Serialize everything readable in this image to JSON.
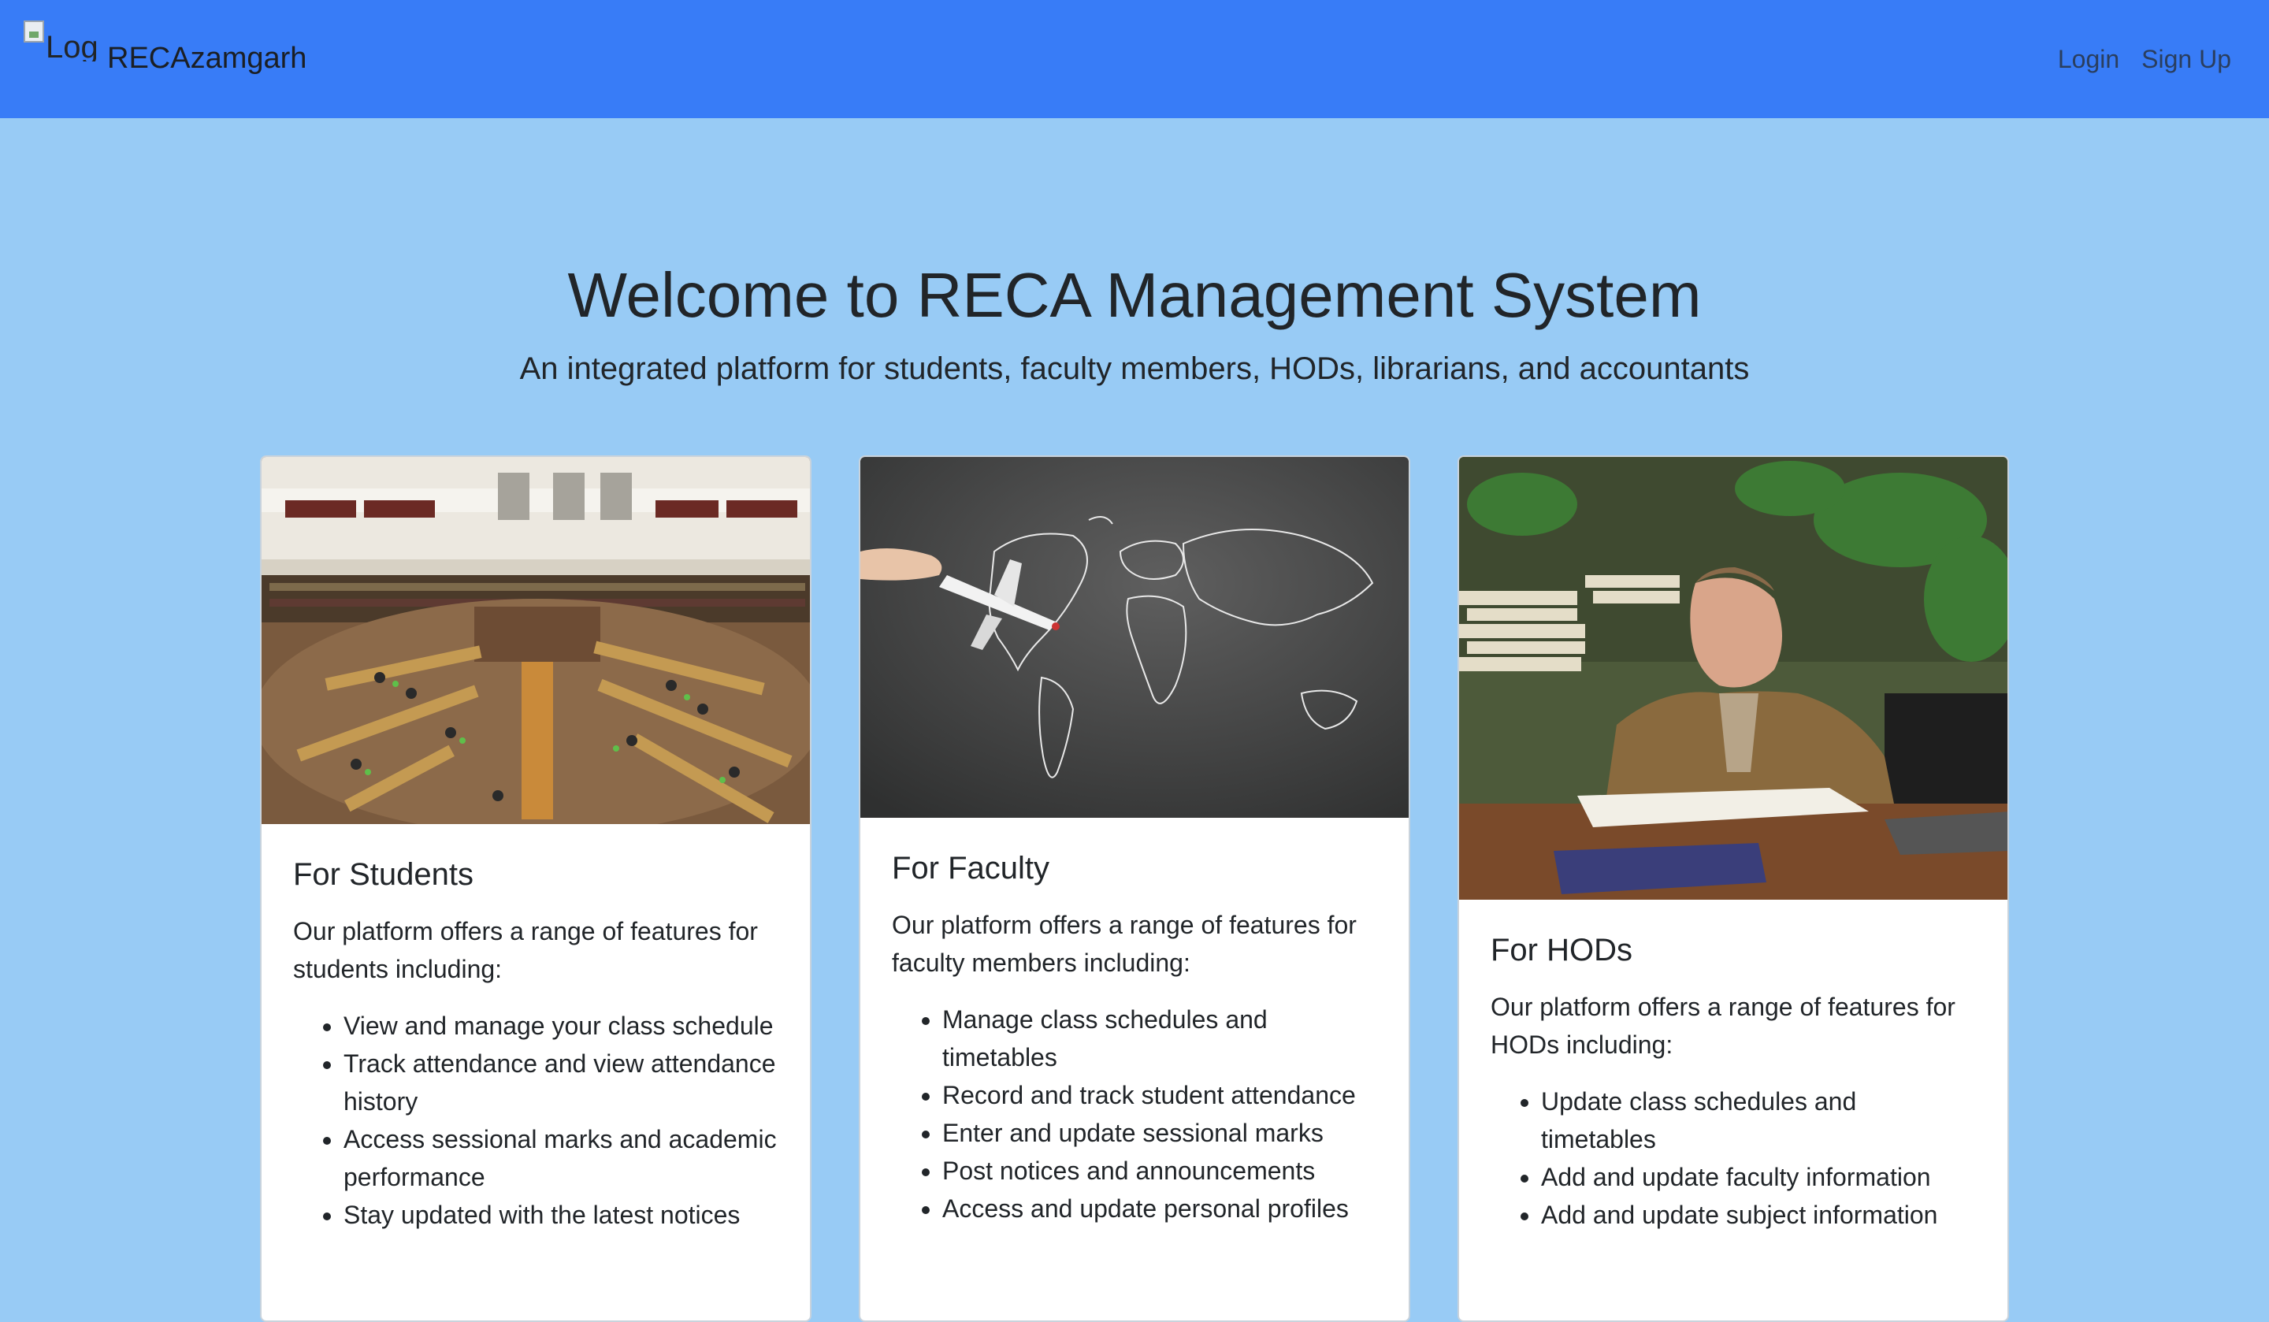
{
  "navbar": {
    "logo_alt": "Logo",
    "brand": "RECAzamgarh",
    "links": [
      "Login",
      "Sign Up"
    ],
    "bg_color": "#387cf7"
  },
  "hero": {
    "title": "Welcome to RECA Management System",
    "subtitle": "An integrated platform for students, faculty members, HODs, librarians, and accountants"
  },
  "page": {
    "bg_color": "#98cbf5"
  },
  "cards": [
    {
      "image_subject": "library reading room",
      "title": "For Students",
      "text": "Our platform offers a range of features for students including:",
      "features": [
        "View and manage your class schedule",
        "Track attendance and view attendance history",
        "Access sessional marks and academic performance",
        "Stay updated with the latest notices"
      ]
    },
    {
      "image_subject": "world map on chalkboard with airplane",
      "title": "For Faculty",
      "text": "Our platform offers a range of features for faculty members including:",
      "features": [
        "Manage class schedules and timetables",
        "Record and track student attendance",
        "Enter and update sessional marks",
        "Post notices and announcements",
        "Access and update personal profiles"
      ]
    },
    {
      "image_subject": "man reading at desk",
      "title": "For HODs",
      "text": "Our platform offers a range of features for HODs including:",
      "features": [
        "Update class schedules and timetables",
        "Add and update faculty information",
        "Add and update subject information"
      ]
    }
  ]
}
